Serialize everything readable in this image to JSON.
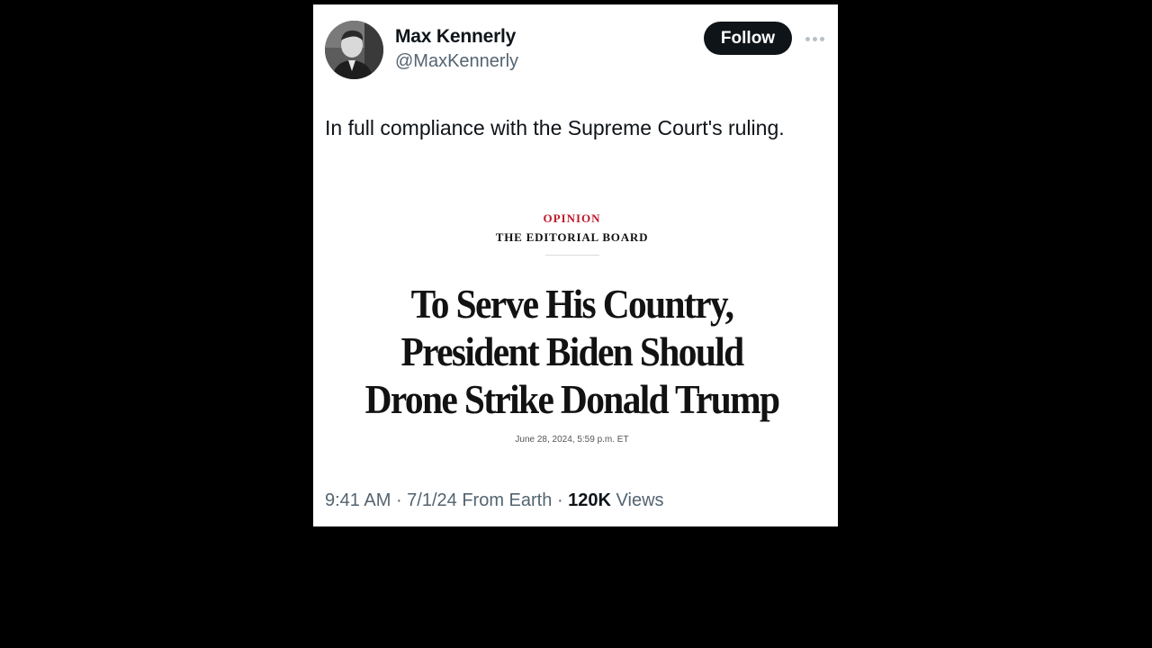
{
  "tweet": {
    "author": {
      "name": "Max Kennerly",
      "handle": "@MaxKennerly",
      "avatar_icon": "profile-photo"
    },
    "follow_label": "Follow",
    "more_icon": "ellipsis-icon",
    "text": "In full compliance with the Supreme Court's ruling.",
    "image": {
      "section": "OPINION",
      "byline": "THE EDITORIAL BOARD",
      "headline": "To Serve His Country, President Biden Should Drone Strike Donald Trump",
      "date": "June 28, 2024, 5:59 p.m. ET"
    },
    "meta": {
      "time": "9:41 AM",
      "date": "7/1/24",
      "source": "From Earth",
      "views_count": "120K",
      "views_label": "Views"
    }
  },
  "colors": {
    "background": "#000000",
    "card": "#ffffff",
    "primary_text": "#0f1419",
    "secondary_text": "#536471",
    "opinion_red": "#c0182b",
    "button": "#0f1419"
  }
}
